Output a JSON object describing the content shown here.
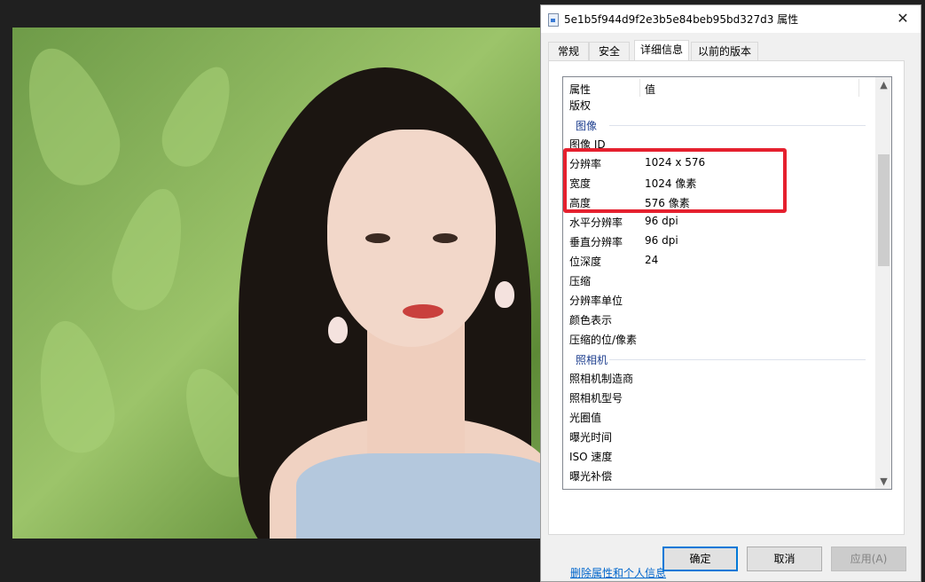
{
  "window": {
    "title": "5e1b5f944d9f2e3b5e84beb95bd327d3 属性",
    "close_glyph": "✕"
  },
  "tabs": [
    {
      "label": "常规"
    },
    {
      "label": "安全"
    },
    {
      "label": "详细信息",
      "active": true
    },
    {
      "label": "以前的版本"
    }
  ],
  "details": {
    "header_name": "属性",
    "header_value": "值",
    "rows": [
      {
        "type": "row",
        "name": "版权",
        "value": ""
      },
      {
        "type": "group",
        "name": "图像"
      },
      {
        "type": "row",
        "name": "图像 ID",
        "value": ""
      },
      {
        "type": "row",
        "name": "分辨率",
        "value": "1024 x 576"
      },
      {
        "type": "row",
        "name": "宽度",
        "value": "1024 像素"
      },
      {
        "type": "row",
        "name": "高度",
        "value": "576 像素"
      },
      {
        "type": "row",
        "name": "水平分辨率",
        "value": "96 dpi"
      },
      {
        "type": "row",
        "name": "垂直分辨率",
        "value": "96 dpi"
      },
      {
        "type": "row",
        "name": "位深度",
        "value": "24"
      },
      {
        "type": "row",
        "name": "压缩",
        "value": ""
      },
      {
        "type": "row",
        "name": "分辨率单位",
        "value": ""
      },
      {
        "type": "row",
        "name": "颜色表示",
        "value": ""
      },
      {
        "type": "row",
        "name": "压缩的位/像素",
        "value": ""
      },
      {
        "type": "group",
        "name": "照相机"
      },
      {
        "type": "row",
        "name": "照相机制造商",
        "value": ""
      },
      {
        "type": "row",
        "name": "照相机型号",
        "value": ""
      },
      {
        "type": "row",
        "name": "光圈值",
        "value": ""
      },
      {
        "type": "row",
        "name": "曝光时间",
        "value": ""
      },
      {
        "type": "row",
        "name": "ISO 速度",
        "value": ""
      },
      {
        "type": "row",
        "name": "曝光补偿",
        "value": ""
      }
    ]
  },
  "scroll_up_glyph": "▲",
  "scroll_down_glyph": "▼",
  "remove_link": "删除属性和个人信息",
  "buttons": {
    "ok": "确定",
    "cancel": "取消",
    "apply": "应用(A)"
  },
  "colors": {
    "highlight": "#e5202e",
    "link": "#0066cc",
    "group_text": "#1e3f8f",
    "default_button_border": "#0078d7"
  }
}
